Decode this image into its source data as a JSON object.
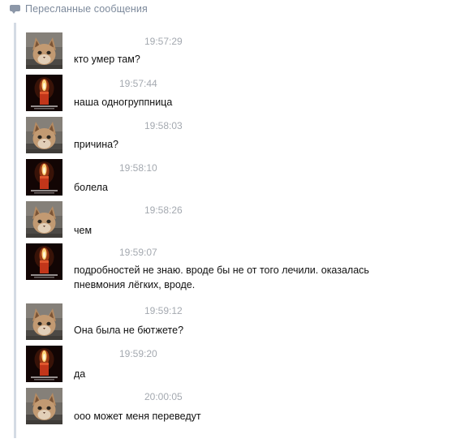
{
  "header": {
    "icon": "message-icon",
    "title": "Пересланные сообщения"
  },
  "messages": [
    {
      "sender": "cat",
      "time": "19:57:29",
      "lines": [
        "кто умер там?"
      ]
    },
    {
      "sender": "candle",
      "time": "19:57:44",
      "lines": [
        "наша одногруппница"
      ]
    },
    {
      "sender": "cat",
      "time": "19:58:03",
      "lines": [
        "причина?"
      ]
    },
    {
      "sender": "candle",
      "time": "19:58:10",
      "lines": [
        "болела"
      ]
    },
    {
      "sender": "cat",
      "time": "19:58:26",
      "lines": [
        "чем"
      ]
    },
    {
      "sender": "candle",
      "time": "19:59:07",
      "lines": [
        "подробностей не знаю. вроде бы не от того лечили. оказалась",
        "пневмония лёгких, вроде."
      ]
    },
    {
      "sender": "cat",
      "time": "19:59:12",
      "lines": [
        "Она была не бютжете?"
      ]
    },
    {
      "sender": "candle",
      "time": "19:59:20",
      "lines": [
        "да"
      ]
    },
    {
      "sender": "cat",
      "time": "20:00:05",
      "lines": [
        "ооо может меня переведут"
      ]
    }
  ],
  "colors": {
    "header_text": "#7d8a9c",
    "timestamp": "#a4a9b0",
    "forward_line": "#d4dbe4"
  }
}
